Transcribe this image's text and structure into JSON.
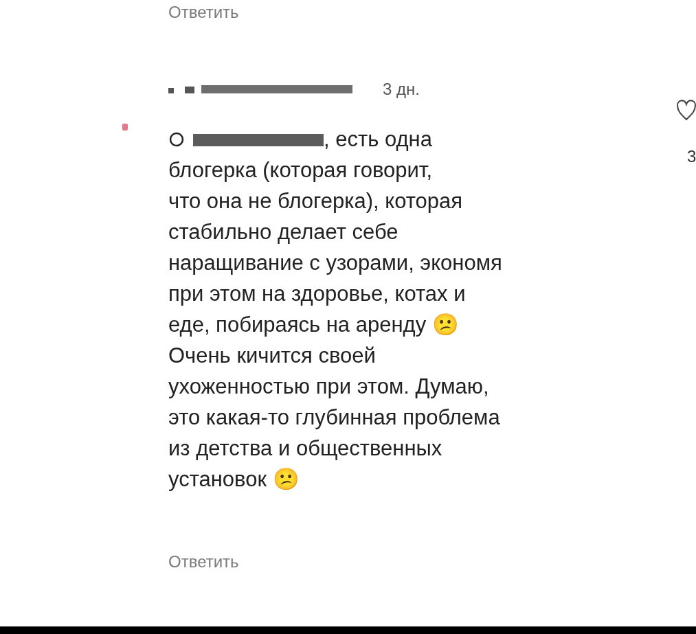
{
  "top_reply": {
    "label": "Ответить"
  },
  "comment": {
    "time": "3 дн.",
    "lines": [
      ", есть одна",
      "блогерка (которая говорит,",
      "что она не блогерка), которая",
      "стабильно делает себе",
      "наращивание с узорами, экономя",
      "при этом на здоровье, котах и",
      "еде, побираясь на аренду 😕",
      "Очень кичится своей",
      "ухоженностью при этом. Думаю,",
      "это какая-то глубинная проблема",
      "из детства и общественных",
      "установок 😕"
    ],
    "reply": "Ответить",
    "like_count": "3"
  }
}
